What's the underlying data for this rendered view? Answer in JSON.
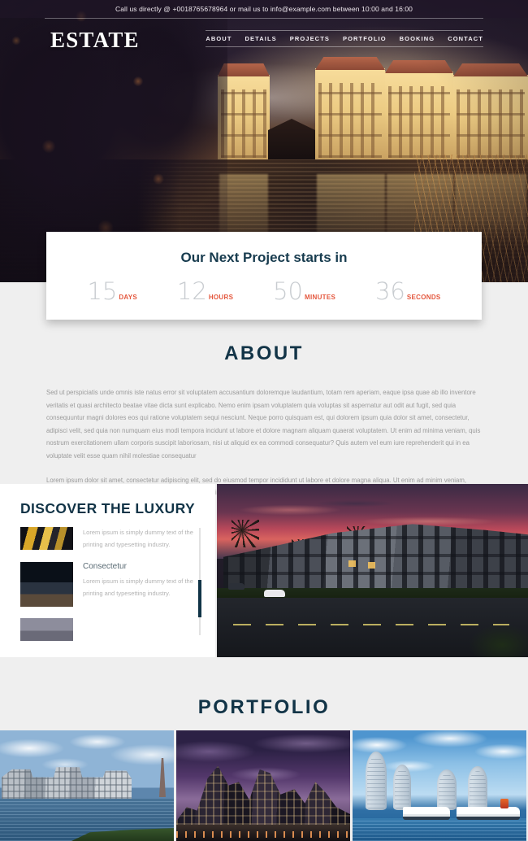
{
  "topbar": {
    "text": "Call us directly @ +0018765678964 or mail us to info@example.com between 10:00 and 16:00"
  },
  "header": {
    "logo": "ESTATE",
    "nav": [
      {
        "label": "ABOUT"
      },
      {
        "label": "DETAILS"
      },
      {
        "label": "PROJECTS"
      },
      {
        "label": "PORTFOLIO"
      },
      {
        "label": "BOOKING"
      },
      {
        "label": "CONTACT"
      }
    ]
  },
  "countdown": {
    "title": "Our Next Project starts in",
    "units": [
      {
        "value": "15",
        "label": "DAYS"
      },
      {
        "value": "12",
        "label": "HOURS"
      },
      {
        "value": "50",
        "label": "MINUTES"
      },
      {
        "value": "36",
        "label": "SECONDS"
      }
    ]
  },
  "about": {
    "title": "ABOUT",
    "paragraphs": [
      "Sed ut perspiciatis unde omnis iste natus error sit voluptatem accusantium doloremque laudantium, totam rem aperiam, eaque ipsa quae ab illo inventore veritatis et quasi architecto beatae vitae dicta sunt explicabo. Nemo enim ipsam voluptatem quia voluptas sit aspernatur aut odit aut fugit, sed quia consequuntur magni dolores eos qui ratione voluptatem sequi nesciunt. Neque porro quisquam est, qui dolorem ipsum quia dolor sit amet, consectetur, adipisci velit, sed quia non numquam eius modi tempora incidunt ut labore et dolore magnam aliquam quaerat voluptatem. Ut enim ad minima veniam, quis nostrum exercitationem ullam corporis suscipit laboriosam, nisi ut aliquid ex ea commodi consequatur? Quis autem vel eum iure reprehenderit qui in ea voluptate velit esse quam nihil molestiae consequatur",
      "Lorem ipsum dolor sit amet, consectetur adipiscing elit, sed do eiusmod tempor incididunt ut labore et dolore magna aliqua. Ut enim ad minim veniam, labore et dolore magnam aliquam quaerat voluptatem. Ut enim ad minima veniam quis nostrud exercitation ullamco laboris nisi ut aliquip ex ea commodo consequat."
    ]
  },
  "discover": {
    "title": "DISCOVER THE LUXURY",
    "items": [
      {
        "title": "",
        "desc": "Lorem ipsum is simply dummy text of the printing and typesetting industry."
      },
      {
        "title": "Consectetur",
        "desc": "Lorem ipsum is simply dummy text of the printing and typesetting industry."
      },
      {
        "title": "",
        "desc": ""
      }
    ]
  },
  "portfolio": {
    "title": "PORTFOLIO",
    "items": [
      {
        "name": "waterfront-crane-houses"
      },
      {
        "name": "dusk-city-skyline"
      },
      {
        "name": "curved-towers-cruise-ships"
      }
    ]
  },
  "colors": {
    "accent_dark": "#123447",
    "accent_orange": "#e4573d",
    "page_background": "#efefef",
    "card_background": "#ffffff",
    "body_text": "#9b9b9b"
  }
}
